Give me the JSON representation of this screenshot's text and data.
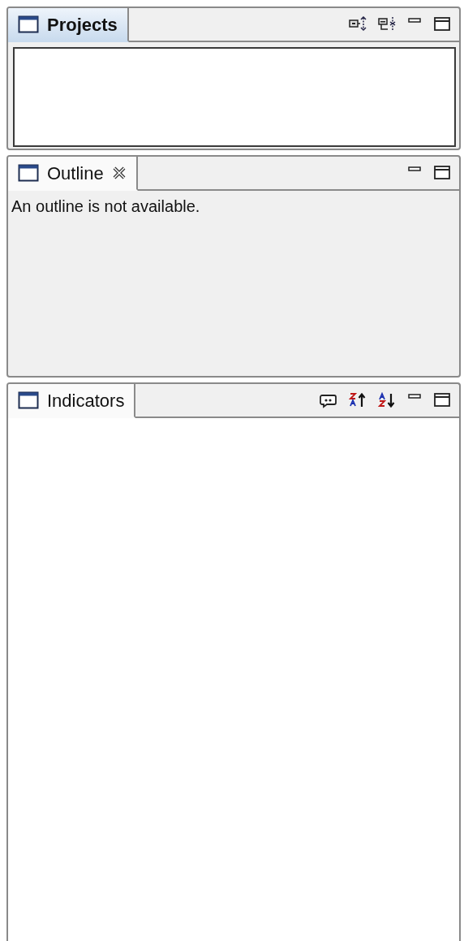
{
  "panels": [
    {
      "title": "Projects",
      "active": true,
      "closable": false,
      "kind": "framed",
      "toolbar": [
        {
          "kind": "collapse"
        },
        {
          "kind": "expand"
        },
        {
          "kind": "minimize"
        },
        {
          "kind": "maximize"
        }
      ]
    },
    {
      "title": "Outline",
      "active": false,
      "closable": true,
      "kind": "message",
      "message": "An outline is not available.",
      "toolbar": [
        {
          "kind": "minimize"
        },
        {
          "kind": "maximize"
        }
      ]
    },
    {
      "title": "Indicators",
      "active": false,
      "closable": false,
      "kind": "blank",
      "toolbar": [
        {
          "kind": "comment"
        },
        {
          "kind": "sort_desc"
        },
        {
          "kind": "sort_asc"
        },
        {
          "kind": "minimize"
        },
        {
          "kind": "maximize"
        }
      ]
    }
  ]
}
